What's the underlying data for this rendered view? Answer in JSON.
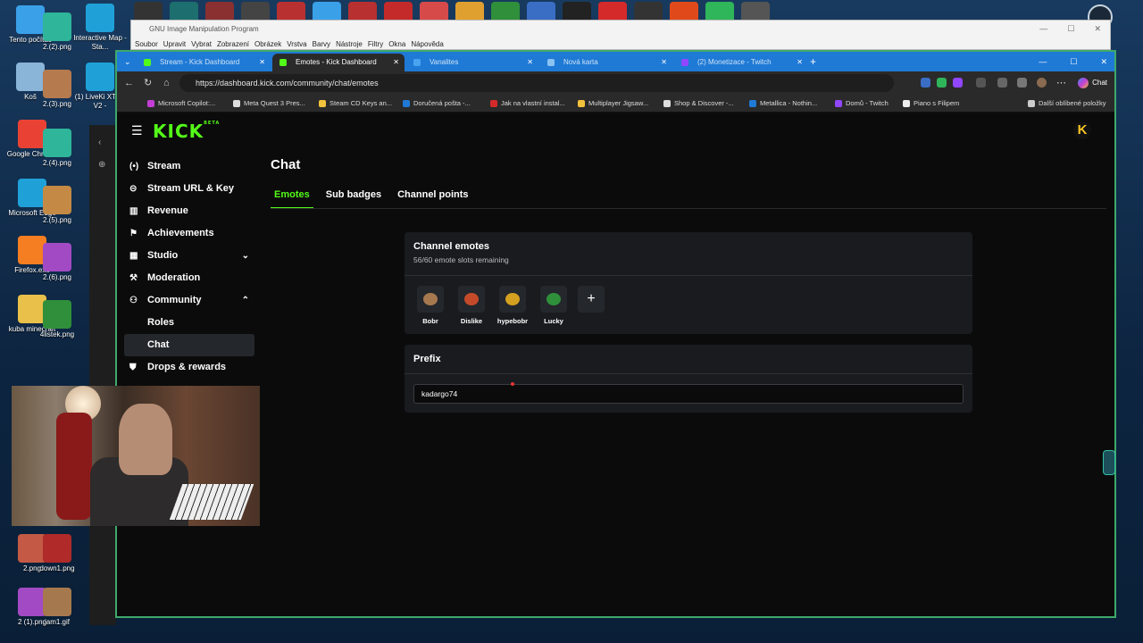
{
  "desktop": {
    "icons": [
      {
        "label": "Tento počítač",
        "color": "#3aa0e8"
      },
      {
        "label": "Koš",
        "color": "#8ab4d8"
      },
      {
        "label": "Google Chrome",
        "color": "#e94235"
      },
      {
        "label": "Microsoft Edge",
        "color": "#1fa1d8"
      },
      {
        "label": "Firefox.exe",
        "color": "#f57e22"
      },
      {
        "label": "kuba minecraft",
        "color": "#e8c04a"
      },
      {
        "label": "2.(2).png",
        "color": "#2fb59a"
      },
      {
        "label": "2.(3).png",
        "color": "#b57a4e"
      },
      {
        "label": "2.(4).png",
        "color": "#2fb59a"
      },
      {
        "label": "2.(5).png",
        "color": "#c48a45"
      },
      {
        "label": "2.(6).png",
        "color": "#a24ac4"
      },
      {
        "label": "4listek.png",
        "color": "#2f8f3a"
      },
      {
        "label": "Interactive Map - Sta...",
        "color": "#1fa1d8"
      },
      {
        "label": "(1) LiveKi XTTS V2 -",
        "color": "#1fa1d8"
      },
      {
        "label": "2.png",
        "color": "#c45a45"
      },
      {
        "label": "down1.png",
        "color": "#b02a2a"
      },
      {
        "label": "2 (1).png",
        "color": "#a24ac4"
      },
      {
        "label": "jam1.gif",
        "color": "#a6784e"
      }
    ],
    "taskbar_top_colors": [
      "#333",
      "#1d6e6e",
      "#8a3030",
      "#444",
      "#b83030",
      "#3aa0e8",
      "#b83030",
      "#c42a2a",
      "#d64a4a",
      "#e0a030",
      "#2f8f3a",
      "#3a6ec4",
      "#222",
      "#d42a2a",
      "#333",
      "#e04a1a",
      "#2fb55a",
      "#555"
    ]
  },
  "gimp": {
    "title": "GNU Image Manipulation Program",
    "menu": [
      "Soubor",
      "Upravit",
      "Vybrat",
      "Zobrazení",
      "Obrázek",
      "Vrstva",
      "Barvy",
      "Nástroje",
      "Filtry",
      "Okna",
      "Nápověda"
    ]
  },
  "browser": {
    "tabs": [
      {
        "label": "Stream - Kick Dashboard",
        "fav": "#53fc18",
        "active": false
      },
      {
        "label": "Emotes - Kick Dashboard",
        "fav": "#53fc18",
        "active": true
      },
      {
        "label": "Vanalites",
        "fav": "#4aa3f0",
        "active": false
      },
      {
        "label": "Nová karta",
        "fav": "#8ac2f2",
        "active": false
      },
      {
        "label": "(2) Monetizace - Twitch",
        "fav": "#9146ff",
        "active": false
      }
    ],
    "url": "https://dashboard.kick.com/community/chat/emotes",
    "chat_button": "Chat",
    "bookmarks": [
      {
        "label": "Microsoft Copilot:...",
        "color": "#c33ed5"
      },
      {
        "label": "Meta Quest 3 Pres...",
        "color": "#ddd"
      },
      {
        "label": "Steam CD Keys an...",
        "color": "#f2c23d"
      },
      {
        "label": "Doručená pošta -...",
        "color": "#1f7ad6"
      },
      {
        "label": "Jak na vlastní instal...",
        "color": "#d42a2a"
      },
      {
        "label": "Multiplayer Jigsaw...",
        "color": "#f2c23d"
      },
      {
        "label": "Shop & Discover -...",
        "color": "#ddd"
      },
      {
        "label": "Metallica - Nothin...",
        "color": "#1f7ad6"
      },
      {
        "label": "Domů - Twitch",
        "color": "#9146ff"
      },
      {
        "label": "Piano s Filipem",
        "color": "#eee"
      },
      {
        "label": "Další oblíbené položky",
        "color": "#ccc"
      }
    ]
  },
  "kick": {
    "logo": "KICK",
    "logo_sup": "BETA",
    "avatar": "K",
    "sidebar": [
      {
        "label": "Stream",
        "icon": "(•)",
        "active": false,
        "chev": ""
      },
      {
        "label": "Stream URL & Key",
        "icon": "⊝",
        "active": false,
        "chev": ""
      },
      {
        "label": "Revenue",
        "icon": "▥",
        "active": false,
        "chev": ""
      },
      {
        "label": "Achievements",
        "icon": "⚑",
        "active": false,
        "chev": ""
      },
      {
        "label": "Studio",
        "icon": "▦",
        "active": false,
        "chev": "⌄"
      },
      {
        "label": "Moderation",
        "icon": "⚒",
        "active": false,
        "chev": ""
      },
      {
        "label": "Community",
        "icon": "⚇",
        "active": false,
        "chev": "⌃"
      },
      {
        "label": "Roles",
        "icon": "",
        "active": false,
        "chev": ""
      },
      {
        "label": "Chat",
        "icon": "",
        "active": true,
        "chev": ""
      },
      {
        "label": "Drops & rewards",
        "icon": "⛊",
        "active": false,
        "chev": ""
      }
    ],
    "page_title": "Chat",
    "tabs": [
      {
        "label": "Emotes",
        "active": true
      },
      {
        "label": "Sub badges",
        "active": false
      },
      {
        "label": "Channel points",
        "active": false
      }
    ],
    "emotes_card": {
      "title": "Channel emotes",
      "subtitle": "56/60 emote slots remaining",
      "emotes": [
        {
          "name": "Bobr",
          "color": "#a6784e"
        },
        {
          "name": "Dislike",
          "color": "#c44a2a"
        },
        {
          "name": "hypebobr",
          "color": "#d4a020"
        },
        {
          "name": "Lucky",
          "color": "#2f8f3a"
        }
      ],
      "add_label": "+"
    },
    "prefix_card": {
      "title": "Prefix",
      "value": "kadargo74"
    }
  }
}
